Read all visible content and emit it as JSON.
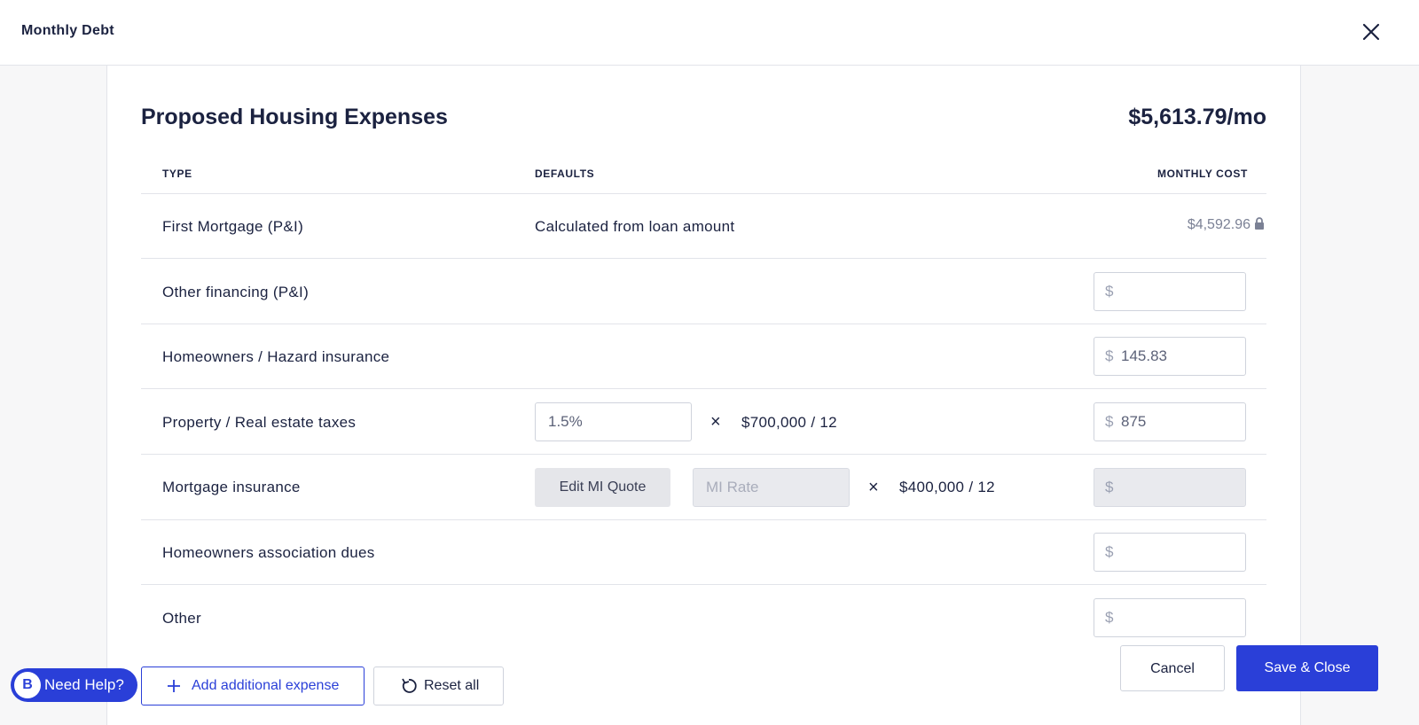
{
  "window": {
    "title": "Monthly Debt"
  },
  "panel": {
    "heading": "Proposed Housing Expenses",
    "total": "$5,613.79/mo"
  },
  "columns": {
    "type": "TYPE",
    "defaults": "DEFAULTS",
    "monthly_cost": "MONTHLY COST"
  },
  "rows": {
    "first_mortgage": {
      "label": "First Mortgage (P&I)",
      "default_text": "Calculated from loan amount",
      "cost": "$4,592.96"
    },
    "other_financing": {
      "label": "Other financing (P&I)",
      "currency": "$",
      "value": ""
    },
    "hazard_insurance": {
      "label": "Homeowners / Hazard insurance",
      "currency": "$",
      "value": "145.83"
    },
    "property_taxes": {
      "label": "Property / Real estate taxes",
      "rate": "1.5%",
      "times": "×",
      "basis": "$700,000 / 12",
      "currency": "$",
      "value": "875"
    },
    "mortgage_insurance": {
      "label": "Mortgage insurance",
      "edit_button": "Edit MI Quote",
      "rate_placeholder": "MI Rate",
      "times": "×",
      "basis": "$400,000 / 12",
      "currency": "$",
      "value": ""
    },
    "hoa_dues": {
      "label": "Homeowners association dues",
      "currency": "$",
      "value": ""
    },
    "other": {
      "label": "Other",
      "currency": "$",
      "value": ""
    }
  },
  "actions": {
    "add_expense": "Add additional expense",
    "reset_all": "Reset all",
    "cancel": "Cancel",
    "save_close": "Save & Close"
  },
  "help": {
    "logo_letter": "B",
    "label": "Need Help?"
  },
  "colors": {
    "accent": "#2a3fd8",
    "text": "#1b2240",
    "muted": "#7b8195",
    "border": "#cfd3dc"
  }
}
